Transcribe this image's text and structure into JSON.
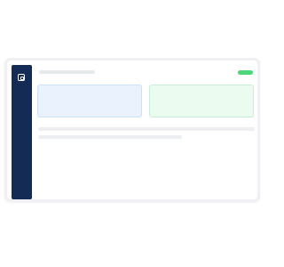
{
  "app": {
    "icon": "app-logo-icon",
    "colors": {
      "sidebar": "#142c55",
      "status": "#4ed77a",
      "card_primary": "#eaf2fe",
      "card_success": "#ebfbef",
      "placeholder": "#e6e9ee"
    }
  }
}
